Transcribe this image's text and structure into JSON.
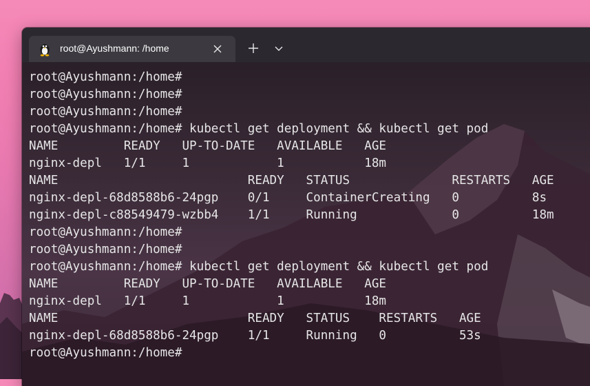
{
  "window": {
    "tab_title": "root@Ayushmann: /home",
    "tab_icon": "tux-penguin-icon",
    "close_icon": "close-icon",
    "new_tab_icon": "plus-icon",
    "dropdown_icon": "chevron-down-icon"
  },
  "terminal": {
    "lines": [
      "root@Ayushmann:/home#",
      "root@Ayushmann:/home#",
      "root@Ayushmann:/home#",
      "root@Ayushmann:/home# kubectl get deployment && kubectl get pod",
      "NAME         READY   UP-TO-DATE   AVAILABLE   AGE",
      "nginx-depl   1/1     1            1           18m",
      "NAME                          READY   STATUS              RESTARTS   AGE",
      "nginx-depl-68d8588b6-24pgp    0/1     ContainerCreating   0          8s",
      "nginx-depl-c88549479-wzbb4    1/1     Running             0          18m",
      "root@Ayushmann:/home#",
      "root@Ayushmann:/home#",
      "root@Ayushmann:/home# kubectl get deployment && kubectl get pod",
      "NAME         READY   UP-TO-DATE   AVAILABLE   AGE",
      "nginx-depl   1/1     1            1           18m",
      "NAME                          READY   STATUS    RESTARTS   AGE",
      "nginx-depl-68d8588b6-24pgp    1/1     Running   0          53s",
      "root@Ayushmann:/home#"
    ]
  }
}
